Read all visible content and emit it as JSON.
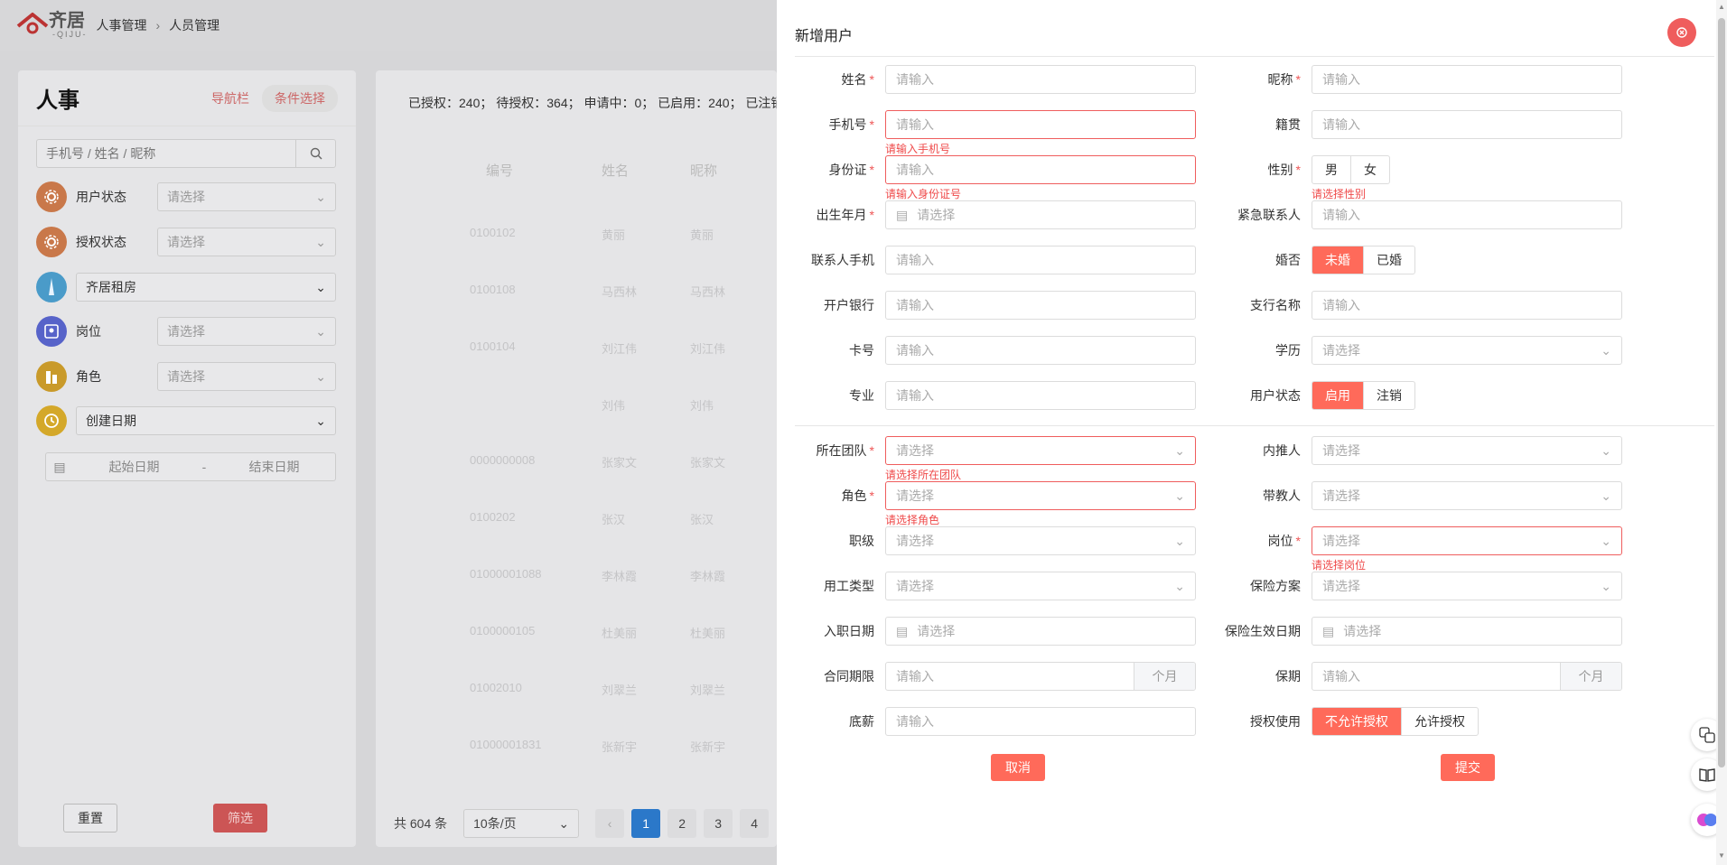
{
  "header": {
    "logo_text": "齐居",
    "logo_sub": "-QIJU-",
    "breadcrumb": [
      "人事管理",
      "人员管理"
    ]
  },
  "left": {
    "title": "人事",
    "nav_link": "导航栏",
    "filter_link": "条件选择",
    "search_placeholder": "手机号 / 姓名 / 昵称",
    "filters": [
      {
        "label": "用户状态",
        "value": "请选择"
      },
      {
        "label": "授权状态",
        "value": "请选择"
      },
      {
        "label": "",
        "value": "齐居租房"
      },
      {
        "label": "岗位",
        "value": "请选择"
      },
      {
        "label": "角色",
        "value": "请选择"
      },
      {
        "label": "",
        "value": "创建日期"
      }
    ],
    "date_start": "起始日期",
    "date_sep": "-",
    "date_end": "结束日期",
    "reset": "重置",
    "filter": "筛选"
  },
  "middle": {
    "stats": "已授权：240； 待授权：364； 申请中：0； 已启用：240； 已注销",
    "headers": [
      "编号",
      "姓名",
      "昵称"
    ],
    "rows": [
      [
        "0100102",
        "黄丽",
        "黄丽"
      ],
      [
        "0100108",
        "马西林",
        "马西林"
      ],
      [
        "0100104",
        "刘江伟",
        "刘江伟"
      ],
      [
        "",
        "刘伟",
        "刘伟"
      ],
      [
        "0000000008",
        "张家文",
        "张家文"
      ],
      [
        "0100202",
        "张汉",
        "张汉"
      ],
      [
        "01000001088",
        "李林霞",
        "李林霞"
      ],
      [
        "0100000105",
        "杜美丽",
        "杜美丽"
      ],
      [
        "01002010",
        "刘翠兰",
        "刘翠兰"
      ],
      [
        "01000001831",
        "张新宇",
        "张新宇"
      ]
    ],
    "total": "共 604 条",
    "page_size": "10条/页",
    "pages": [
      "1",
      "2",
      "3",
      "4"
    ]
  },
  "drawer": {
    "title": "新增用户",
    "cancel": "取消",
    "submit": "提交",
    "fields": {
      "name": {
        "label": "姓名",
        "placeholder": "请输入"
      },
      "nickname": {
        "label": "昵称",
        "placeholder": "请输入"
      },
      "phone": {
        "label": "手机号",
        "placeholder": "请输入",
        "error": "请输入手机号"
      },
      "native": {
        "label": "籍贯",
        "placeholder": "请输入"
      },
      "idcard": {
        "label": "身份证",
        "placeholder": "请输入",
        "error": "请输入身份证号"
      },
      "gender": {
        "label": "性别",
        "options": [
          "男",
          "女"
        ],
        "error": "请选择性别"
      },
      "birth": {
        "label": "出生年月",
        "placeholder": "请选择"
      },
      "emergency": {
        "label": "紧急联系人",
        "placeholder": "请输入"
      },
      "contact_phone": {
        "label": "联系人手机",
        "placeholder": "请输入"
      },
      "married": {
        "label": "婚否",
        "options": [
          "未婚",
          "已婚"
        ]
      },
      "bank": {
        "label": "开户银行",
        "placeholder": "请输入"
      },
      "branch": {
        "label": "支行名称",
        "placeholder": "请输入"
      },
      "card": {
        "label": "卡号",
        "placeholder": "请输入"
      },
      "education": {
        "label": "学历",
        "placeholder": "请选择"
      },
      "major": {
        "label": "专业",
        "placeholder": "请输入"
      },
      "user_status": {
        "label": "用户状态",
        "options": [
          "启用",
          "注销"
        ]
      },
      "team": {
        "label": "所在团队",
        "placeholder": "请选择",
        "error": "请选择所在团队"
      },
      "referrer": {
        "label": "内推人",
        "placeholder": "请选择"
      },
      "role": {
        "label": "角色",
        "placeholder": "请选择",
        "error": "请选择角色"
      },
      "mentor": {
        "label": "带教人",
        "placeholder": "请选择"
      },
      "grade": {
        "label": "职级",
        "placeholder": "请选择"
      },
      "post": {
        "label": "岗位",
        "placeholder": "请选择",
        "error": "请选择岗位"
      },
      "emp_type": {
        "label": "用工类型",
        "placeholder": "请选择"
      },
      "insurance": {
        "label": "保险方案",
        "placeholder": "请选择"
      },
      "entry_date": {
        "label": "入职日期",
        "placeholder": "请选择"
      },
      "ins_date": {
        "label": "保险生效日期",
        "placeholder": "请选择"
      },
      "contract": {
        "label": "合同期限",
        "placeholder": "请输入",
        "unit": "个月"
      },
      "warranty": {
        "label": "保期",
        "placeholder": "请输入",
        "unit": "个月"
      },
      "salary": {
        "label": "底薪",
        "placeholder": "请输入"
      },
      "auth": {
        "label": "授权使用",
        "options": [
          "不允许授权",
          "允许授权"
        ]
      }
    }
  },
  "colors": {
    "accent": "#ff6a5a",
    "error": "#ef4a4a",
    "page_active": "#2b78c9"
  }
}
